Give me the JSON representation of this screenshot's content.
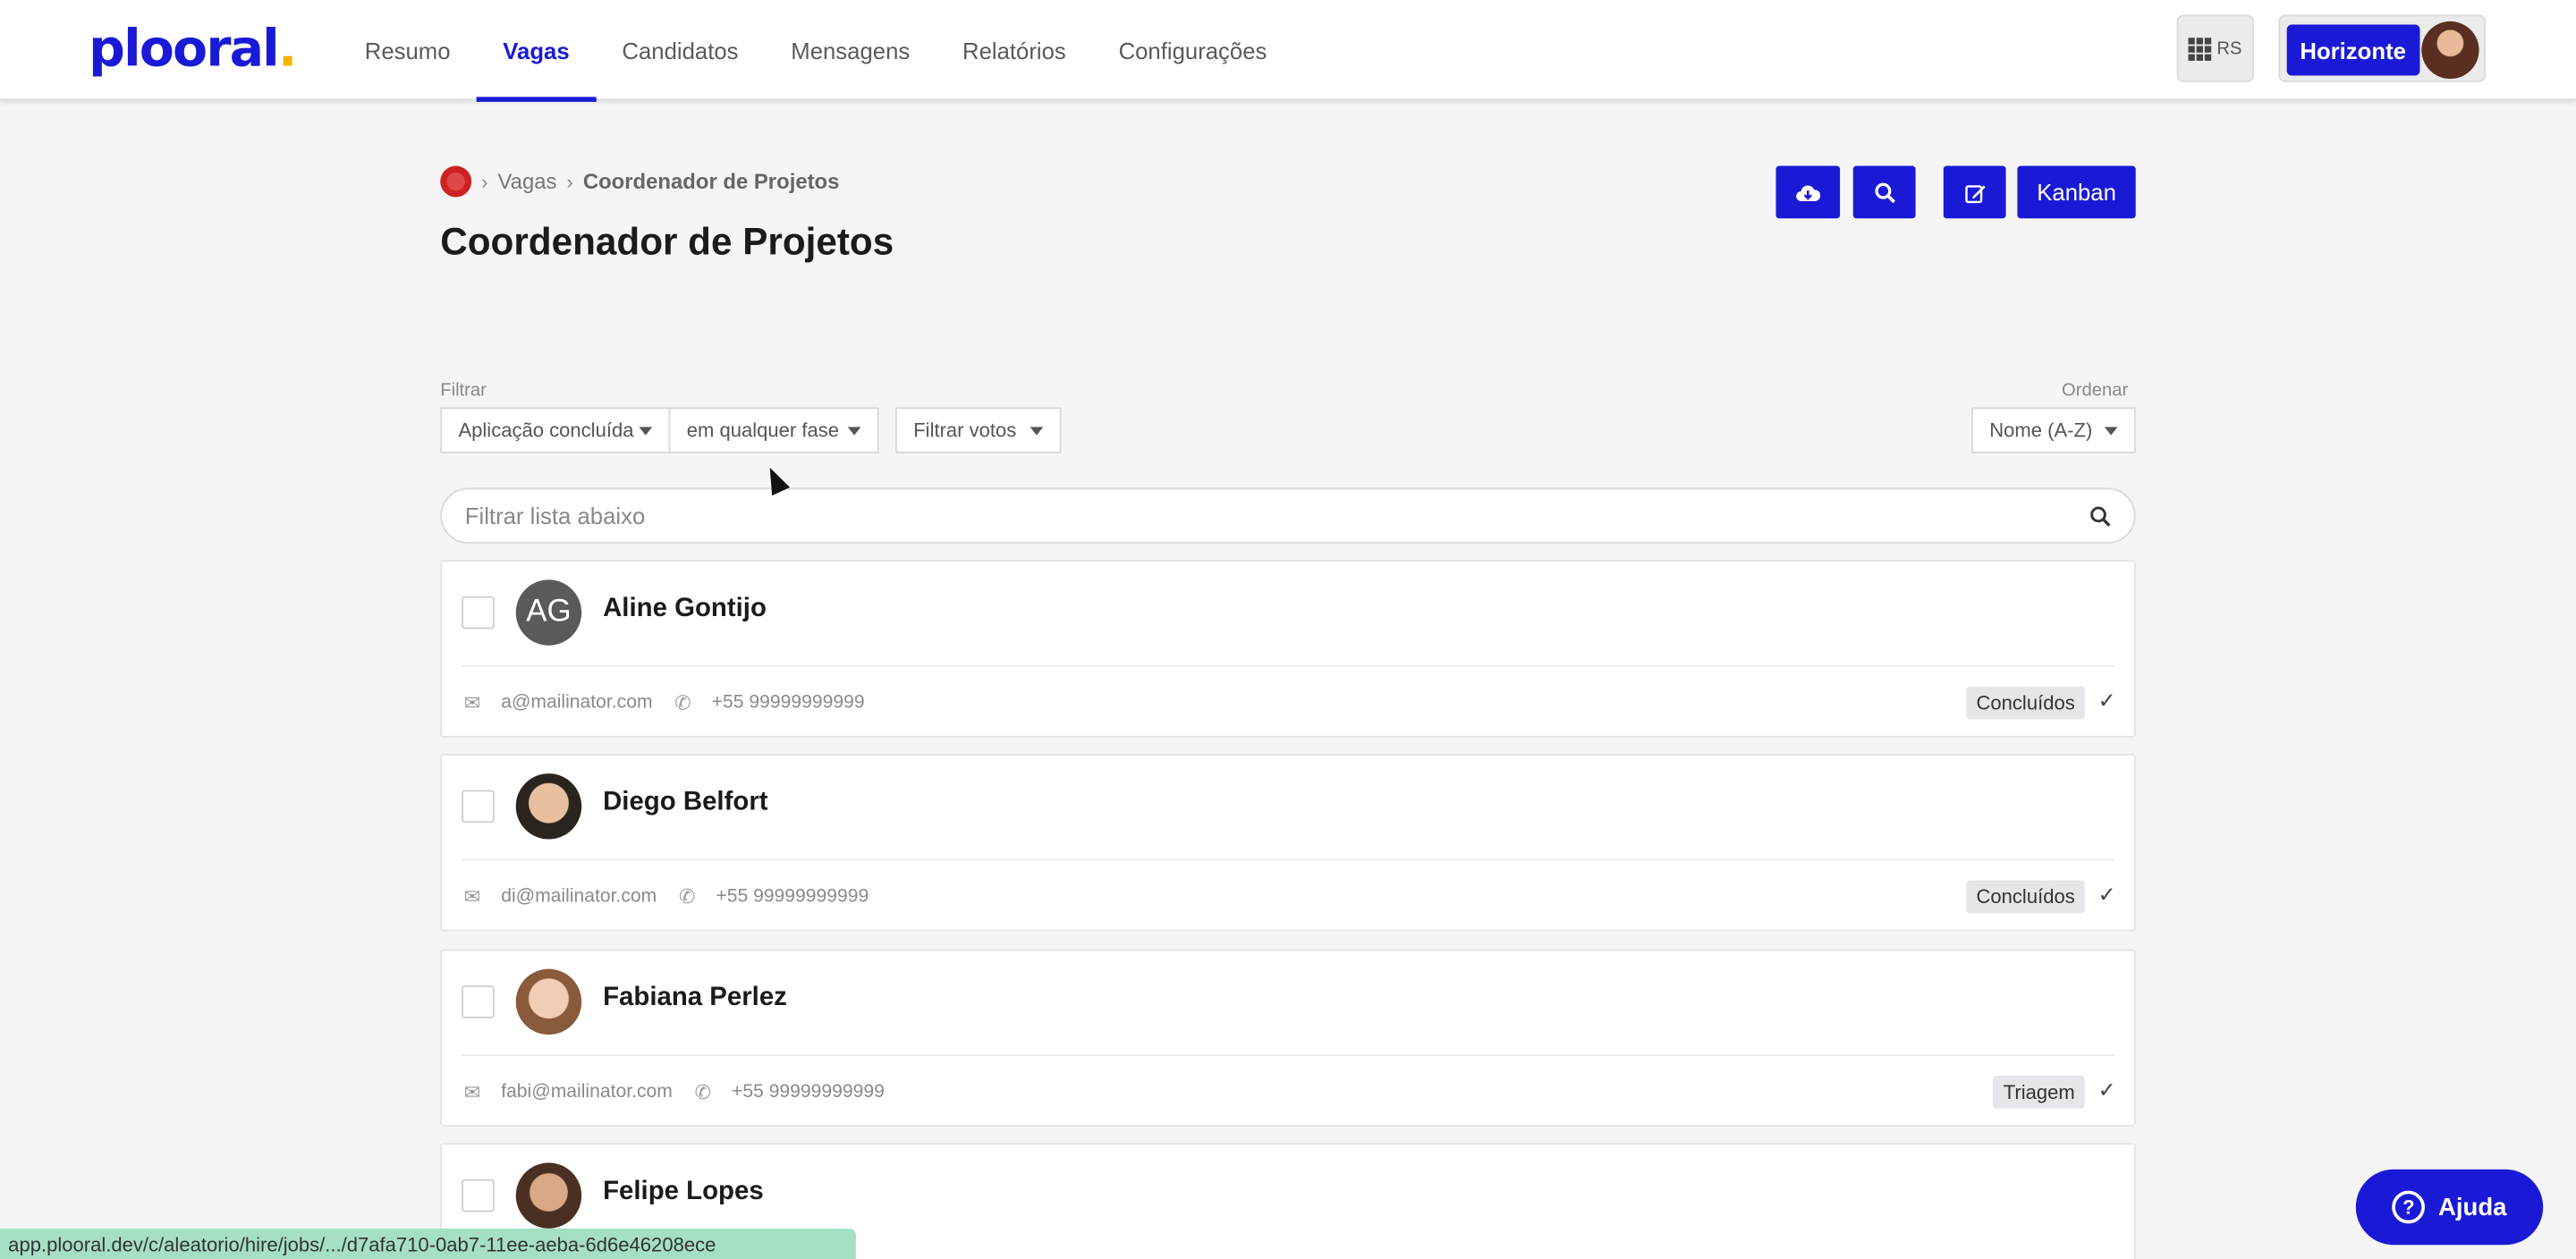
{
  "brand": {
    "logo_text": "plooral",
    "logo_dot": ".",
    "accent": "#1a1ad6"
  },
  "nav": [
    {
      "label": "Resumo",
      "active": false
    },
    {
      "label": "Vagas",
      "active": true
    },
    {
      "label": "Candidatos",
      "active": false
    },
    {
      "label": "Mensagens",
      "active": false
    },
    {
      "label": "Relatórios",
      "active": false
    },
    {
      "label": "Configurações",
      "active": false
    }
  ],
  "header_right": {
    "apps_initials": "RS",
    "org_label": "Horizonte"
  },
  "breadcrumb": {
    "section": "Vagas",
    "current": "Coordenador de Projetos"
  },
  "page_title": "Coordenador de Projetos",
  "toolbar": {
    "download_icon": "cloud-download-icon",
    "search_icon": "search-icon",
    "edit_icon": "edit-icon",
    "kanban_label": "Kanban"
  },
  "filters": {
    "label": "Filtrar",
    "status": "Aplicação concluída",
    "phase": "em qualquer fase",
    "votes": "Filtrar votos",
    "sort_label": "Ordenar",
    "sort": "Nome (A-Z)"
  },
  "search": {
    "placeholder": "Filtrar lista abaixo"
  },
  "candidates": [
    {
      "name": "Aline Gontijo",
      "initials": "AG",
      "email": "a@mailinator.com",
      "phone": "+55 99999999999",
      "stage": "Concluídos"
    },
    {
      "name": "Diego Belfort",
      "initials": "",
      "email": "di@mailinator.com",
      "phone": "+55 99999999999",
      "stage": "Concluídos"
    },
    {
      "name": "Fabiana Perlez",
      "initials": "",
      "email": "fabi@mailinator.com",
      "phone": "+55 99999999999",
      "stage": "Triagem"
    },
    {
      "name": "Felipe Lopes",
      "initials": "",
      "email": "",
      "phone": "",
      "stage": ""
    }
  ],
  "status_url": "app.plooral.dev/c/aleatorio/hire/jobs/.../d7afa710-0ab7-11ee-aeba-6d6e46208ece",
  "help": {
    "label": "Ajuda"
  }
}
